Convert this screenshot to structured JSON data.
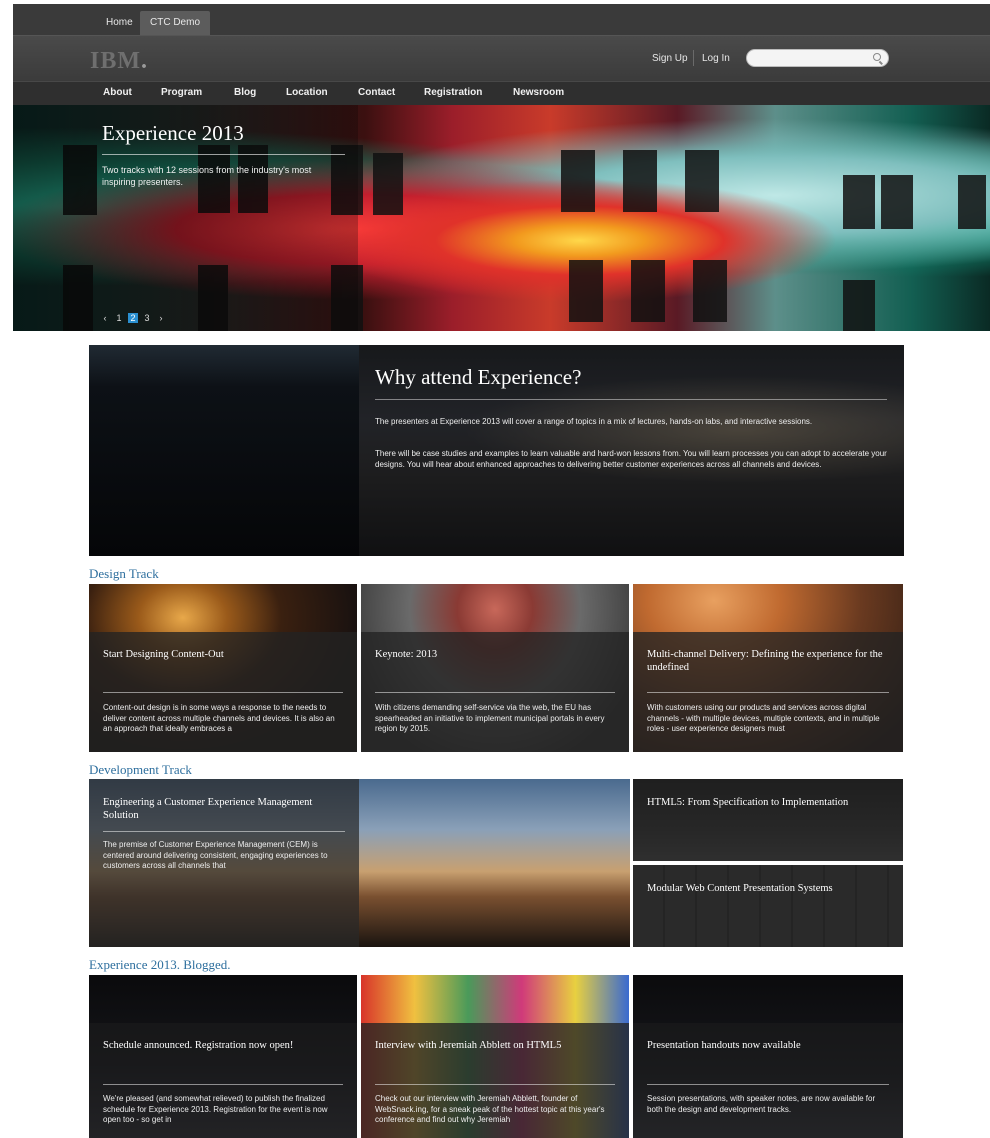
{
  "topbar": {
    "tabs": [
      {
        "label": "Home"
      },
      {
        "label": "CTC Demo"
      }
    ]
  },
  "brand": {
    "logo": "IBM"
  },
  "auth": {
    "signup": "Sign Up",
    "login": "Log In"
  },
  "search": {
    "placeholder": ""
  },
  "nav": {
    "items": [
      "About",
      "Program",
      "Blog",
      "Location",
      "Contact",
      "Registration",
      "Newsroom"
    ]
  },
  "hero": {
    "title": "Experience 2013",
    "text": "Two tracks with 12 sessions from the industry's most inspiring presenters.",
    "pager": {
      "prev": "‹",
      "pages": [
        "1",
        "2",
        "3"
      ],
      "active_page": "2",
      "next": "›"
    }
  },
  "why": {
    "title": "Why attend Experience?",
    "p1": "The presenters at Experience 2013 will cover a range of topics in a mix of lectures, hands-on labs, and interactive sessions.",
    "p2": "There will be case studies and examples to learn valuable and hard-won lessons from. You will learn processes you can adopt to accelerate your designs. You will hear about enhanced approaches to delivering better customer experiences across all channels and devices."
  },
  "design_track": {
    "heading": "Design Track",
    "cards": [
      {
        "title": "Start Designing Content-Out",
        "text": "Content-out design is in some ways a response to the needs to deliver content across multiple channels and devices. It is also an an approach that ideally embraces a"
      },
      {
        "title": "Keynote: 2013",
        "text": "With citizens demanding self-service via the web, the EU has spearheaded an initiative to implement municipal portals in every region by 2015."
      },
      {
        "title": "Multi-channel Delivery: Defining the experience for the undefined",
        "text": "With customers using our products and services across digital channels - with multiple devices, multiple contexts, and in multiple roles - user experience designers must"
      }
    ]
  },
  "dev_track": {
    "heading": "Development Track",
    "feature": {
      "title": "Engineering a Customer Experience Management Solution",
      "text": "The premise of Customer Experience Management (CEM) is centered around delivering consistent, engaging experiences to customers across all channels that"
    },
    "side": [
      {
        "title": "HTML5: From Specification to Implementation"
      },
      {
        "title": "Modular Web Content Presentation Systems"
      }
    ]
  },
  "blogged": {
    "heading": "Experience 2013. Blogged.",
    "cards": [
      {
        "title": "Schedule announced. Registration now open!",
        "text": "We're pleased (and somewhat relieved) to publish the finalized schedule for Experience 2013. Registration for the event is now open too - so get in"
      },
      {
        "title": "Interview with Jeremiah Abblett on HTML5",
        "text": "Check out our interview with Jeremiah Abblett, founder of WebSnack.ing, for a sneak peak of the hottest topic at this year's conference and find out why Jeremiah"
      },
      {
        "title": "Presentation handouts now available",
        "text": "Session presentations, with speaker notes, are now available for both the design and development tracks."
      }
    ]
  }
}
